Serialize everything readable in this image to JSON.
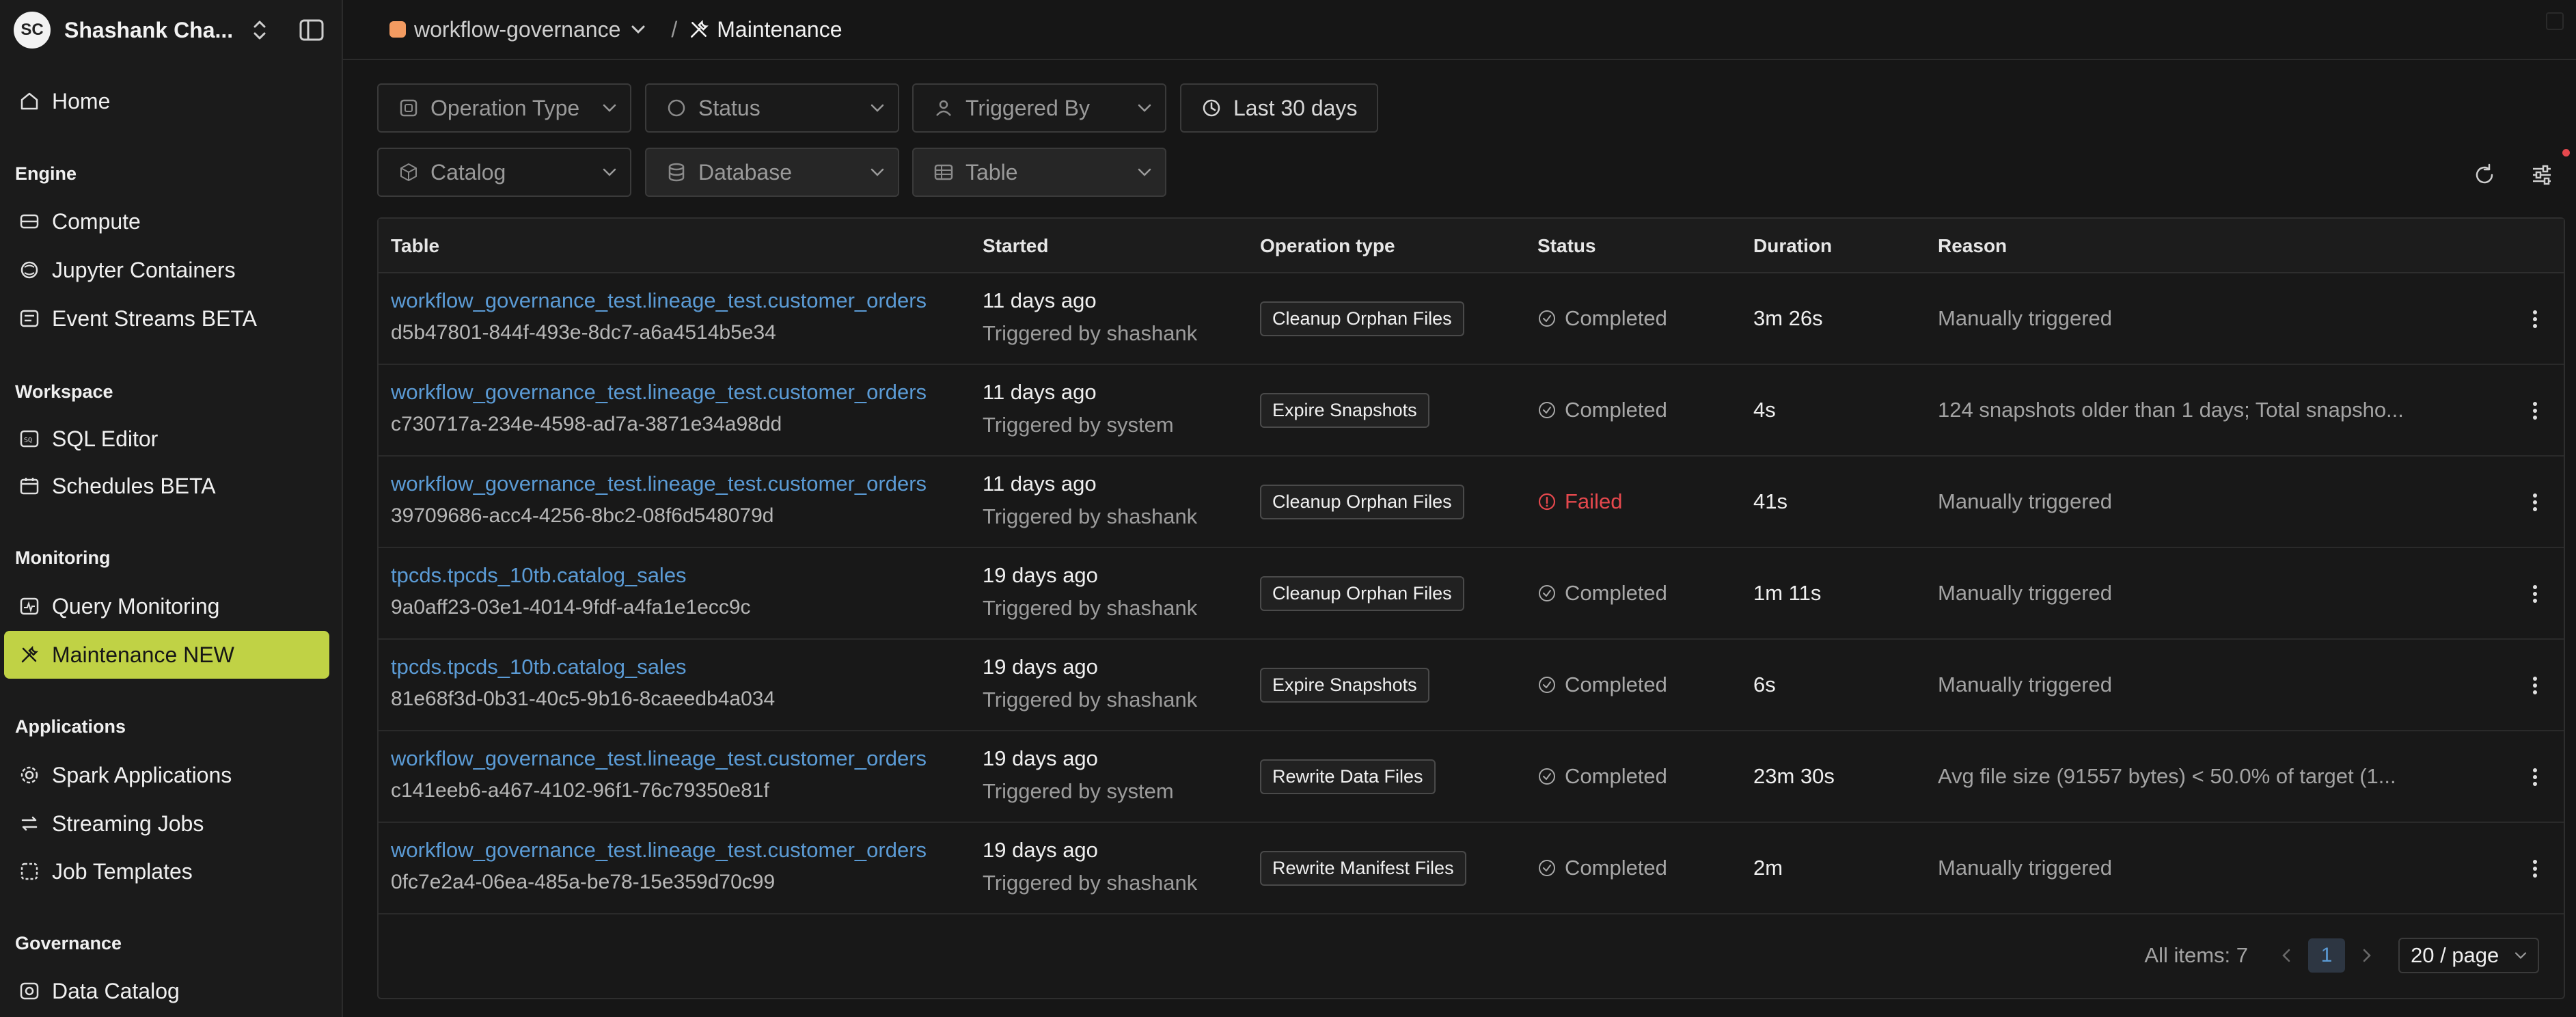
{
  "user": {
    "initials": "SC",
    "name": "Shashank Cha..."
  },
  "sidebar": {
    "home": "Home",
    "sections": {
      "engine": "Engine",
      "workspace": "Workspace",
      "monitoring": "Monitoring",
      "applications": "Applications",
      "governance": "Governance"
    },
    "items": {
      "compute": "Compute",
      "jupyter": "Jupyter Containers",
      "event_streams": "Event Streams BETA",
      "sql_editor": "SQL Editor",
      "schedules": "Schedules BETA",
      "query_monitoring": "Query Monitoring",
      "maintenance": "Maintenance NEW",
      "spark_apps": "Spark Applications",
      "streaming_jobs": "Streaming Jobs",
      "job_templates": "Job Templates",
      "data_catalog": "Data Catalog"
    },
    "active": "maintenance",
    "accent_color": "#c0d245"
  },
  "header": {
    "workspace": "workflow-governance",
    "workspace_color": "#f39b61",
    "separator": "/",
    "page": "Maintenance"
  },
  "filters": {
    "operation_type": "Operation Type",
    "status": "Status",
    "triggered_by": "Triggered By",
    "date_range": "Last 30 days",
    "catalog": "Catalog",
    "database": "Database",
    "table": "Table"
  },
  "table": {
    "columns": [
      "Table",
      "Started",
      "Operation type",
      "Status",
      "Duration",
      "Reason"
    ],
    "rows": [
      {
        "table": "workflow_governance_test.lineage_test.customer_orders",
        "id": "d5b47801-844f-493e-8dc7-a6a4514b5e34",
        "started": "11 days ago",
        "triggered_by": "Triggered by shashank",
        "operation": "Cleanup Orphan Files",
        "status": "Completed",
        "duration": "3m 26s",
        "reason": "Manually triggered"
      },
      {
        "table": "workflow_governance_test.lineage_test.customer_orders",
        "id": "c730717a-234e-4598-ad7a-3871e34a98dd",
        "started": "11 days ago",
        "triggered_by": "Triggered by system",
        "operation": "Expire Snapshots",
        "status": "Completed",
        "duration": "4s",
        "reason": "124 snapshots older than 1 days; Total snapsho..."
      },
      {
        "table": "workflow_governance_test.lineage_test.customer_orders",
        "id": "39709686-acc4-4256-8bc2-08f6d548079d",
        "started": "11 days ago",
        "triggered_by": "Triggered by shashank",
        "operation": "Cleanup Orphan Files",
        "status": "Failed",
        "duration": "41s",
        "reason": "Manually triggered"
      },
      {
        "table": "tpcds.tpcds_10tb.catalog_sales",
        "id": "9a0aff23-03e1-4014-9fdf-a4fa1e1ecc9c",
        "started": "19 days ago",
        "triggered_by": "Triggered by shashank",
        "operation": "Cleanup Orphan Files",
        "status": "Completed",
        "duration": "1m 11s",
        "reason": "Manually triggered"
      },
      {
        "table": "tpcds.tpcds_10tb.catalog_sales",
        "id": "81e68f3d-0b31-40c5-9b16-8caeedb4a034",
        "started": "19 days ago",
        "triggered_by": "Triggered by shashank",
        "operation": "Expire Snapshots",
        "status": "Completed",
        "duration": "6s",
        "reason": "Manually triggered"
      },
      {
        "table": "workflow_governance_test.lineage_test.customer_orders",
        "id": "c141eeb6-a467-4102-96f1-76c79350e81f",
        "started": "19 days ago",
        "triggered_by": "Triggered by system",
        "operation": "Rewrite Data Files",
        "status": "Completed",
        "duration": "23m 30s",
        "reason": "Avg file size (91557 bytes) < 50.0% of target (1..."
      },
      {
        "table": "workflow_governance_test.lineage_test.customer_orders",
        "id": "0fc7e2a4-06ea-485a-be78-15e359d70c99",
        "started": "19 days ago",
        "triggered_by": "Triggered by shashank",
        "operation": "Rewrite Manifest Files",
        "status": "Completed",
        "duration": "2m",
        "reason": "Manually triggered"
      }
    ]
  },
  "pagination": {
    "total": "All items: 7",
    "current_page": "1",
    "page_size": "20 / page"
  },
  "colors": {
    "link": "#5b9bd5",
    "failed": "#e5484d"
  }
}
